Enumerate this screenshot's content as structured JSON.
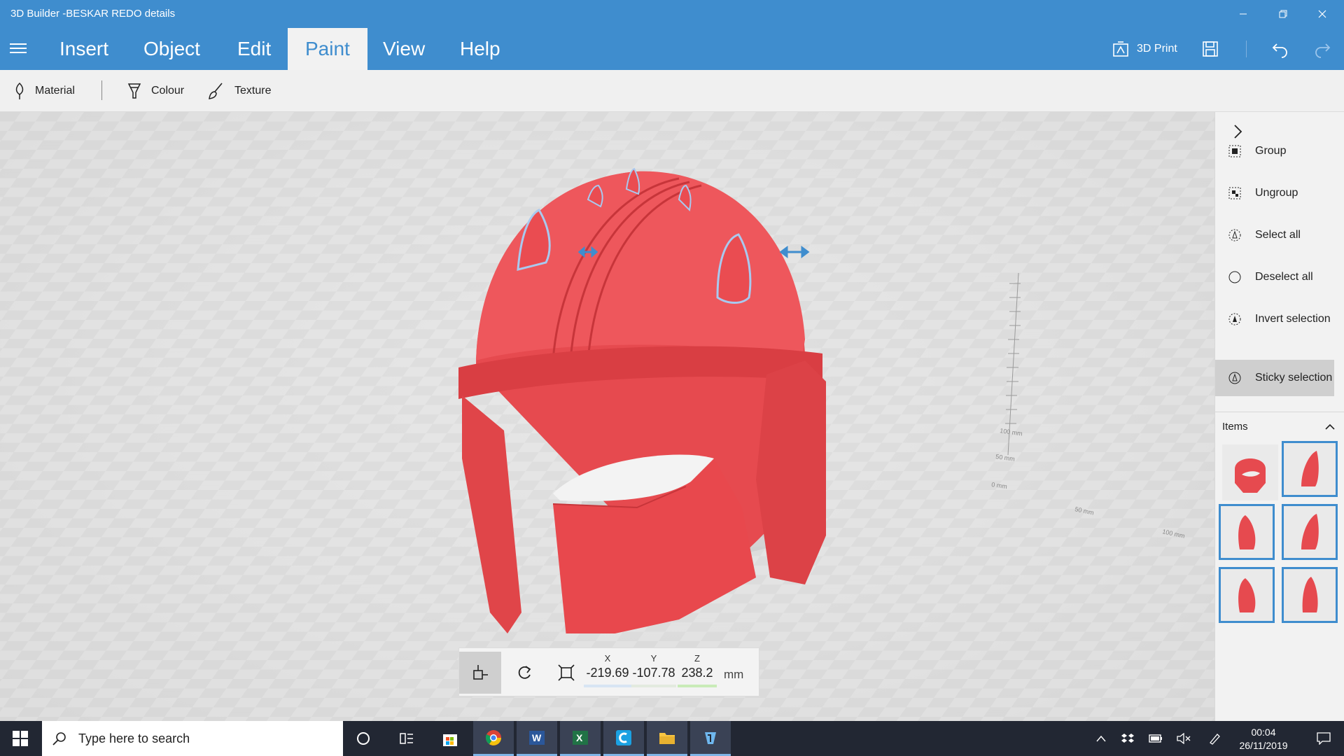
{
  "window": {
    "title": "3D Builder -BESKAR REDO details",
    "minimize_icon": "minimize-icon",
    "maximize_icon": "restore-icon",
    "close_icon": "close-icon"
  },
  "menu": {
    "items": [
      {
        "label": "Insert"
      },
      {
        "label": "Object"
      },
      {
        "label": "Edit"
      },
      {
        "label": "Paint",
        "active": true
      },
      {
        "label": "View"
      },
      {
        "label": "Help"
      }
    ],
    "print_label": "3D Print"
  },
  "ribbon": {
    "material": "Material",
    "colour": "Colour",
    "texture": "Texture"
  },
  "viewport": {
    "model_color": "#e8454b",
    "selection_color": "#6fa9e3",
    "ruler_labels": [
      "0 mm",
      "50 mm",
      "100 mm",
      "50 mm",
      "100 mm"
    ]
  },
  "coordinates": {
    "x_label": "X",
    "y_label": "Y",
    "z_label": "Z",
    "x": "-219.69",
    "y": "-107.78",
    "z": "238.2",
    "unit": "mm"
  },
  "panel": {
    "actions": [
      {
        "label": "Group"
      },
      {
        "label": "Ungroup"
      },
      {
        "label": "Select all"
      },
      {
        "label": "Deselect all"
      },
      {
        "label": "Invert selection"
      },
      {
        "label": "Sticky selection",
        "active": true
      }
    ],
    "items_header": "Items"
  },
  "taskbar": {
    "search_placeholder": "Type here to search",
    "time": "00:04",
    "date": "26/11/2019"
  },
  "colors": {
    "accent": "#3f8dce",
    "taskbar": "#222733"
  }
}
